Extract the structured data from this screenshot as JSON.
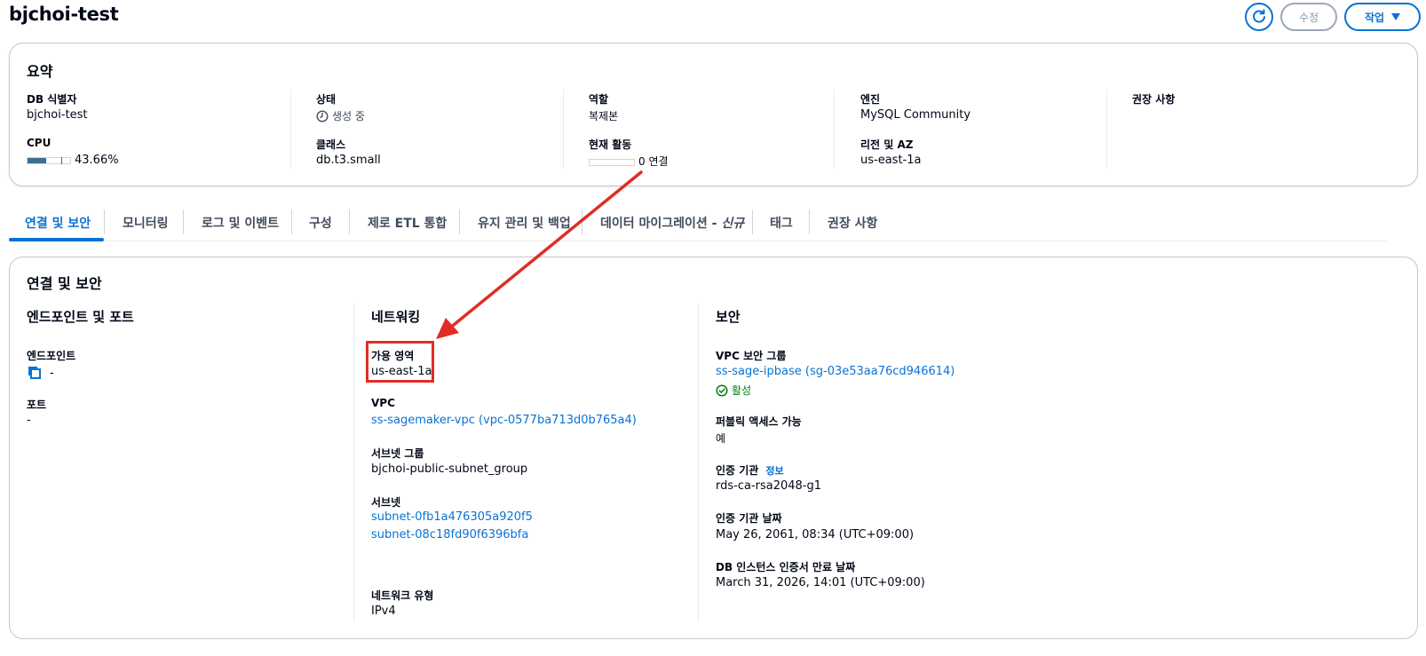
{
  "header": {
    "title": "bjchoi-test",
    "edit_label": "수정",
    "actions_label": "작업"
  },
  "summary": {
    "title": "요약",
    "db_identifier_label": "DB 식별자",
    "db_identifier": "bjchoi-test",
    "cpu_label": "CPU",
    "cpu_value": "43.66%",
    "cpu_fraction": 0.4366,
    "status_label": "상태",
    "status": "생성 중",
    "class_label": "클래스",
    "class": "db.t3.small",
    "role_label": "역할",
    "role": "복제본",
    "activity_label": "현재 활동",
    "activity": "0 연결",
    "engine_label": "엔진",
    "engine": "MySQL Community",
    "region_label": "리전 및 AZ",
    "region": "us-east-1a",
    "recommendations_label": "권장 사항"
  },
  "tabs": [
    {
      "label": "연결 및 보안"
    },
    {
      "label": "모니터링"
    },
    {
      "label": "로그 및 이벤트"
    },
    {
      "label": "구성"
    },
    {
      "label": "제로 ETL 통합"
    },
    {
      "label": "유지 관리 및 백업"
    },
    {
      "label": "데이터 마이그레이션 -",
      "suffix": "신규"
    },
    {
      "label": "태그"
    },
    {
      "label": "권장 사항"
    }
  ],
  "connectivity": {
    "title": "연결 및 보안",
    "endpoint_section": {
      "heading": "엔드포인트 및 포트",
      "endpoint_label": "엔드포인트",
      "endpoint_value": "-",
      "port_label": "포트",
      "port_value": "-"
    },
    "networking_section": {
      "heading": "네트워킹",
      "az_label": "가용 영역",
      "az_value": "us-east-1a",
      "vpc_label": "VPC",
      "vpc_value": "ss-sagemaker-vpc (vpc-0577ba713d0b765a4)",
      "subnet_group_label": "서브넷 그룹",
      "subnet_group_value": "bjchoi-public-subnet_group",
      "subnets_label": "서브넷",
      "subnets": [
        "subnet-0fb1a476305a920f5",
        "subnet-08c18fd90f6396bfa"
      ],
      "network_type_label": "네트워크 유형",
      "network_type_value": "IPv4"
    },
    "security_section": {
      "heading": "보안",
      "sg_label": "VPC 보안 그룹",
      "sg_value": "ss-sage-ipbase (sg-03e53aa76cd946614)",
      "sg_status": "활성",
      "public_label": "퍼블릭 액세스 가능",
      "public_value": "예",
      "ca_label": "인증 기관",
      "ca_info": "정보",
      "ca_value": "rds-ca-rsa2048-g1",
      "ca_date_label": "인증 기관 날짜",
      "ca_date_value": "May 26, 2061, 08:34 (UTC+09:00)",
      "cert_expiry_label": "DB 인스턴스 인증서 만료 날짜",
      "cert_expiry_value": "March 31, 2026, 14:01 (UTC+09:00)"
    }
  },
  "colors": {
    "accent": "#0972d3",
    "annotation": "#e02d26",
    "success": "#037f0c"
  }
}
